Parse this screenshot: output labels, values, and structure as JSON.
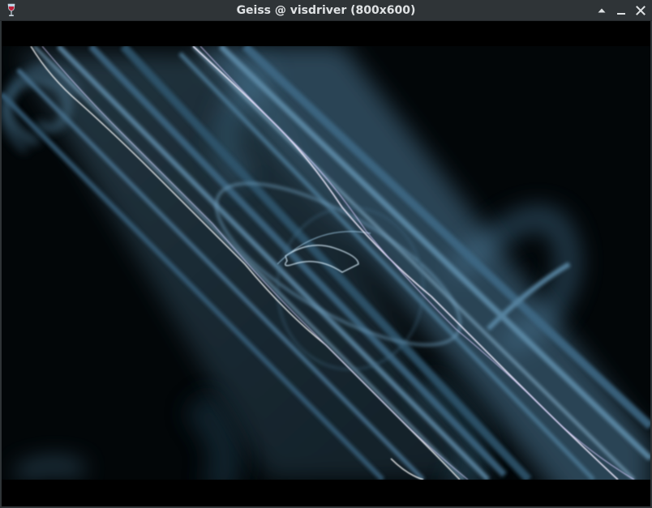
{
  "window": {
    "title": "Geiss @ visdriver (800x600)"
  },
  "icons": {
    "app": "wine-glass-icon",
    "shade": "shade-up-icon",
    "minimize": "minimize-icon",
    "close": "close-icon"
  },
  "colors": {
    "titlebar": "#2f3437",
    "title_text": "#dfe2e4",
    "visual_bg": "#000000",
    "trail": "#6e9bb8",
    "highlight": "#e8e2ff"
  }
}
